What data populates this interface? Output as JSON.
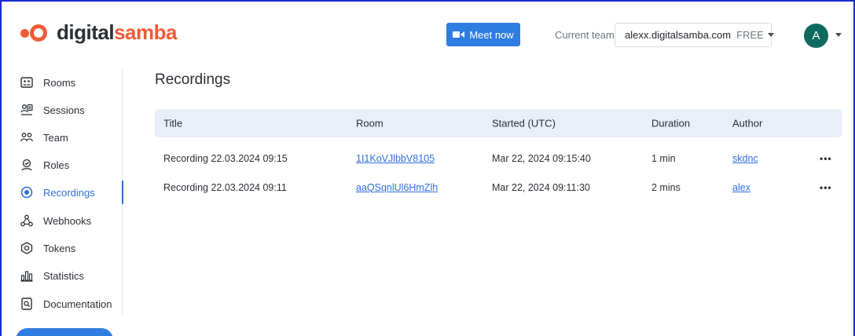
{
  "brand": {
    "part1": "digital",
    "part2": "samba",
    "accent": "#f05a36"
  },
  "header": {
    "meet_now": "Meet now",
    "team_label": "Current team",
    "team_name": "alexx.digitalsamba.com",
    "team_plan": "FREE",
    "avatar_letter": "A"
  },
  "sidebar": {
    "items": [
      {
        "label": "Rooms",
        "icon": "rooms-icon"
      },
      {
        "label": "Sessions",
        "icon": "sessions-icon"
      },
      {
        "label": "Team",
        "icon": "team-icon"
      },
      {
        "label": "Roles",
        "icon": "roles-icon"
      },
      {
        "label": "Recordings",
        "icon": "recordings-icon",
        "active": true
      },
      {
        "label": "Webhooks",
        "icon": "webhooks-icon"
      },
      {
        "label": "Tokens",
        "icon": "tokens-icon"
      },
      {
        "label": "Statistics",
        "icon": "statistics-icon"
      },
      {
        "label": "Documentation",
        "icon": "documentation-icon"
      }
    ]
  },
  "main": {
    "title": "Recordings",
    "columns": [
      "Title",
      "Room",
      "Started (UTC)",
      "Duration",
      "Author"
    ],
    "rows": [
      {
        "title": "Recording 22.03.2024 09:15",
        "room": "1I1KoVJlbbV8105",
        "started": "Mar 22, 2024 09:15:40",
        "duration": "1 min",
        "author": "skdnc",
        "more": "•••"
      },
      {
        "title": "Recording 22.03.2024 09:11",
        "room": "aaQSqnlUl6HmZlh",
        "started": "Mar 22, 2024 09:11:30",
        "duration": "2 mins",
        "author": "alex",
        "more": "•••"
      }
    ]
  },
  "colors": {
    "primary": "#2f7de1",
    "link": "#2f6fde",
    "header_row": "#e9eff9",
    "avatar": "#0e6a5d"
  }
}
